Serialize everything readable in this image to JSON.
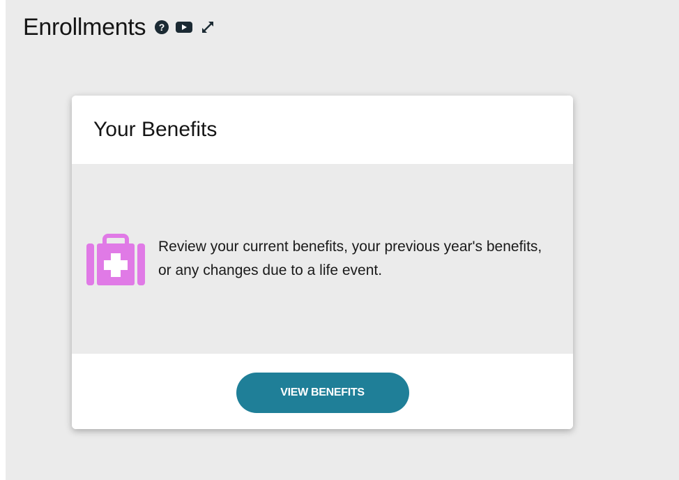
{
  "page": {
    "title": "Enrollments"
  },
  "header_icons": [
    {
      "name": "help-icon"
    },
    {
      "name": "video-icon"
    },
    {
      "name": "expand-icon"
    }
  ],
  "card": {
    "title": "Your Benefits",
    "icon": "medical-kit-icon",
    "description": "Review your current benefits, your previous year's benefits, or any changes due to a life event.",
    "button_label": "VIEW BENEFITS"
  },
  "colors": {
    "page_background": "#ebebeb",
    "card_background": "#ffffff",
    "card_body_background": "#ebebeb",
    "icon_dark": "#1b2a33",
    "kit_icon": "#e07ae6",
    "button": "#1f7f98",
    "button_text": "#ffffff"
  }
}
